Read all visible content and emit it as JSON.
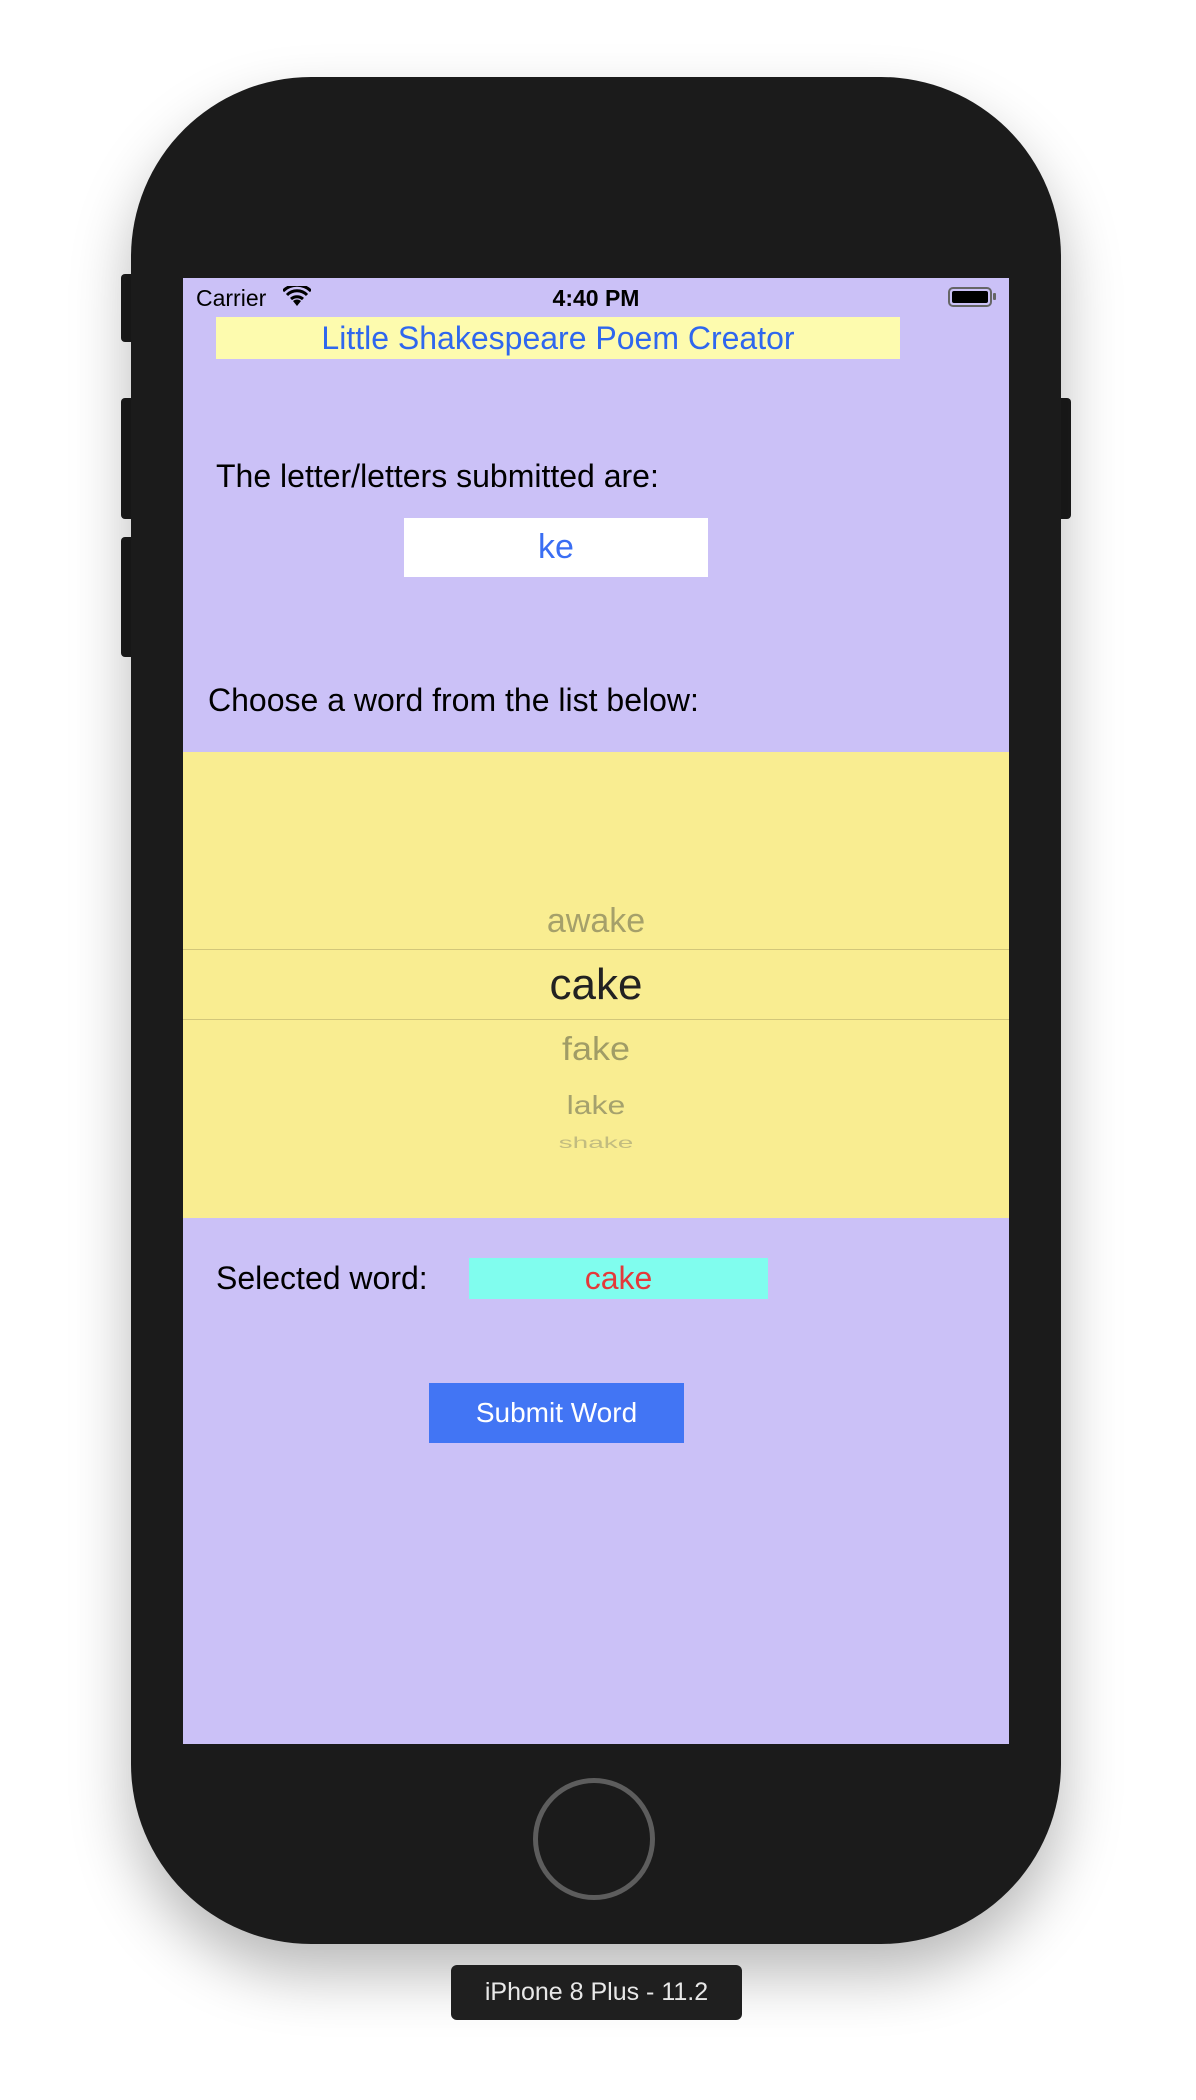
{
  "status_bar": {
    "carrier": "Carrier",
    "time": "4:40 PM"
  },
  "app": {
    "title": "Little Shakespeare Poem Creator",
    "letters_label": "The letter/letters submitted are:",
    "letters_value": "ke",
    "choose_label": "Choose a word from the list below:",
    "picker": {
      "items": [
        "awake",
        "cake",
        "fake",
        "lake",
        "shake"
      ],
      "selected": "cake"
    },
    "selected_label": "Selected word:",
    "selected_value": "cake",
    "submit_label": "Submit Word"
  },
  "device_label": "iPhone 8 Plus - 11.2",
  "colors": {
    "background": "#cbc1f7",
    "title_bg": "#fdfbae",
    "picker_bg": "#f9ed91",
    "selected_bg": "#80fdee",
    "selected_text": "#e4393a",
    "button": "#4275f4",
    "link_blue": "#2f67ee"
  }
}
